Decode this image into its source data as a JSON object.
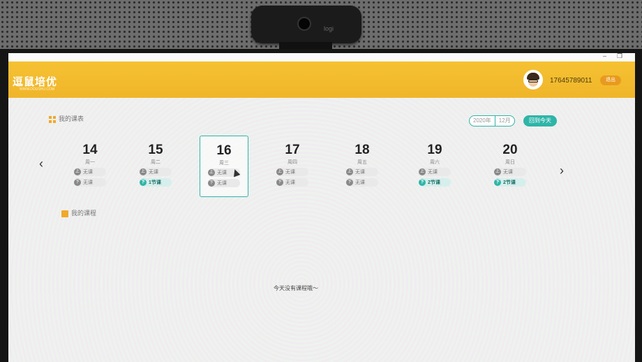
{
  "camera": {
    "brand": "logi"
  },
  "window": {
    "minimize": "–",
    "restore": "❐"
  },
  "header": {
    "logo": "逗鼠培优",
    "logo_sub": "WWW.DOUSHU.COM",
    "phone": "17645789011",
    "logout": "退出"
  },
  "schedule": {
    "title": "我的课表",
    "year": "2020年",
    "month": "12月",
    "today_button": "回到今天",
    "prev_icon": "chevron-left-icon",
    "next_icon": "chevron-right-icon",
    "days": [
      {
        "num": "14",
        "weekday": "周一",
        "slot1": "无课",
        "slot2": "无课"
      },
      {
        "num": "15",
        "weekday": "周二",
        "slot1": "无课",
        "slot2": "1节课"
      },
      {
        "num": "16",
        "weekday": "周三",
        "slot1": "无课",
        "slot2": "无课"
      },
      {
        "num": "17",
        "weekday": "周四",
        "slot1": "无课",
        "slot2": "无课"
      },
      {
        "num": "18",
        "weekday": "周五",
        "slot1": "无课",
        "slot2": "无课"
      },
      {
        "num": "19",
        "weekday": "周六",
        "slot1": "无课",
        "slot2": "2节课"
      },
      {
        "num": "20",
        "weekday": "周日",
        "slot1": "无课",
        "slot2": "2节课"
      }
    ],
    "slot_badges": {
      "first": "上",
      "second": "下"
    }
  },
  "courses": {
    "title": "我的课程",
    "empty_message": "今天没有课程哦～"
  },
  "colors": {
    "brand": "#f0b52a",
    "accent": "#2eb5a8"
  }
}
